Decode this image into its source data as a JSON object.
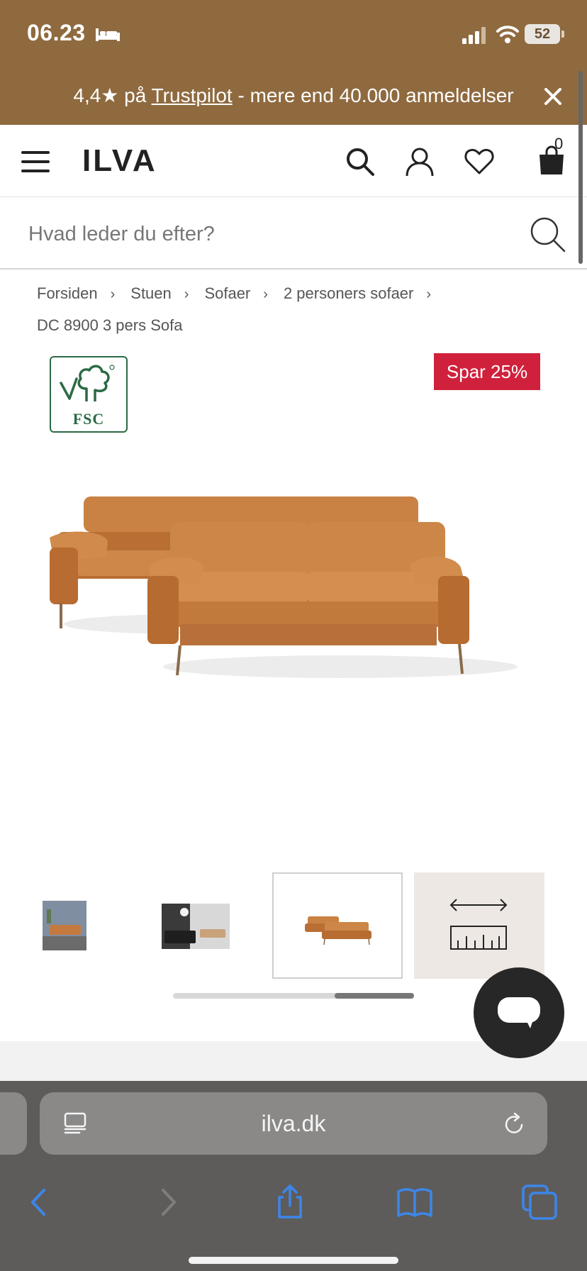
{
  "status_bar": {
    "time": "06.23",
    "battery": "52"
  },
  "trust_banner": {
    "prefix": "4,4★ på ",
    "link": "Trustpilot",
    "suffix": " - mere end 40.000 anmeldelser"
  },
  "header": {
    "logo": "ILVA",
    "cart_count": "0"
  },
  "search": {
    "placeholder": "Hvad leder du efter?"
  },
  "breadcrumb": {
    "items": [
      "Forsiden",
      "Stuen",
      "Sofaer",
      "2 personers sofaer"
    ],
    "separator": "›",
    "current": "DC 8900 3 pers Sofa"
  },
  "badges": {
    "fsc": "FSC",
    "sale": "Spar 25%"
  },
  "browser": {
    "url": "ilva.dk"
  },
  "colors": {
    "banner": "#8f6a3f",
    "sale": "#d0213c",
    "fsc_green": "#2b6a45",
    "sofa": "#c47a3e",
    "browser_blue": "#3d86ea"
  },
  "thumbnail_scroll_position": 0.67
}
